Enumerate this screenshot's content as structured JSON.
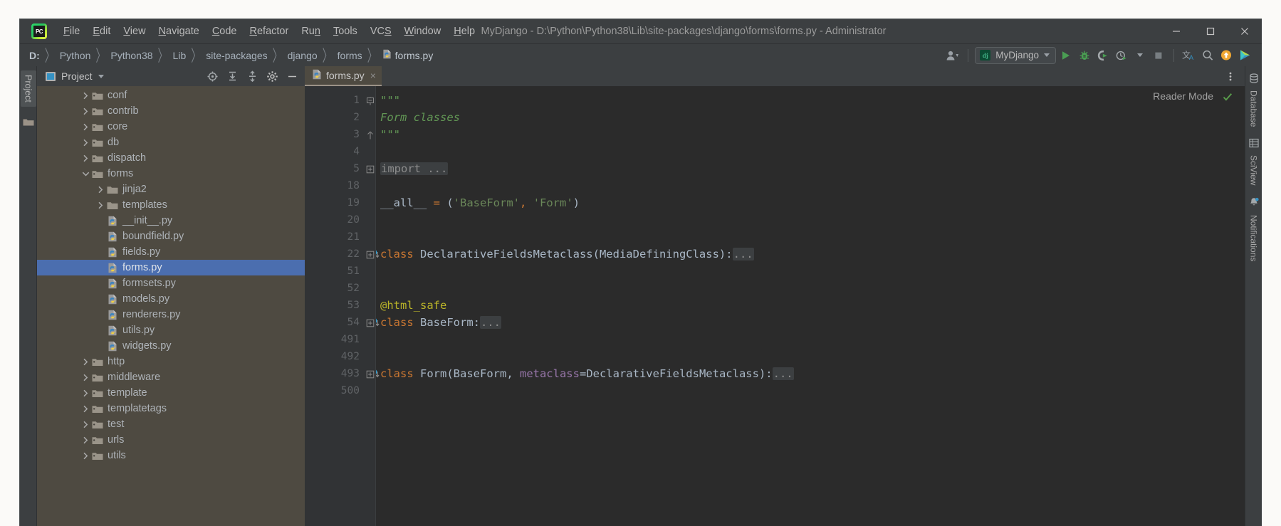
{
  "window": {
    "title": "MyDjango - D:\\Python\\Python38\\Lib\\site-packages\\django\\forms\\forms.py - Administrator",
    "app_icon": "pycharm-logo-icon",
    "minimize_label": "Minimize",
    "maximize_label": "Maximize",
    "close_label": "Close"
  },
  "menubar": {
    "items": [
      {
        "label": "File",
        "mnemonic": "F"
      },
      {
        "label": "Edit",
        "mnemonic": "E"
      },
      {
        "label": "View",
        "mnemonic": "V"
      },
      {
        "label": "Navigate",
        "mnemonic": "N"
      },
      {
        "label": "Code",
        "mnemonic": "C"
      },
      {
        "label": "Refactor",
        "mnemonic": "R"
      },
      {
        "label": "Run",
        "mnemonic": "n"
      },
      {
        "label": "Tools",
        "mnemonic": "T"
      },
      {
        "label": "VCS",
        "mnemonic": "S"
      },
      {
        "label": "Window",
        "mnemonic": "W"
      },
      {
        "label": "Help",
        "mnemonic": "H"
      }
    ]
  },
  "breadcrumb": {
    "items": [
      "D:",
      "Python",
      "Python38",
      "Lib",
      "site-packages",
      "django",
      "forms",
      "forms.py"
    ],
    "separator": "〉",
    "file_icon": "python-file-icon"
  },
  "toolbar": {
    "user_icon": "user-account-icon",
    "run_config": {
      "name": "MyDjango",
      "icon": "django-icon"
    },
    "buttons": [
      {
        "name": "run-button",
        "icon": "play-icon"
      },
      {
        "name": "debug-button",
        "icon": "bug-icon"
      },
      {
        "name": "run-with-coverage",
        "icon": "coverage-icon"
      },
      {
        "name": "profile-button",
        "icon": "clock-run-icon"
      },
      {
        "name": "stop-button",
        "icon": "stop-icon"
      },
      {
        "name": "translate-button",
        "icon": "translate-icon"
      },
      {
        "name": "search-everywhere",
        "icon": "search-icon"
      },
      {
        "name": "update-project",
        "icon": "arrow-up-circle-icon"
      },
      {
        "name": "plugin-button",
        "icon": "color-play-icon"
      }
    ]
  },
  "left_rail": {
    "tab_label": "Project",
    "folder_icon": "folder-icon"
  },
  "right_rail": {
    "items": [
      {
        "label": "Database",
        "icon": "database-icon"
      },
      {
        "label": "SciView",
        "icon": "sciview-icon"
      },
      {
        "label": "Notifications",
        "icon": "bell-icon"
      }
    ]
  },
  "project_panel": {
    "title": "Project",
    "dropdown_icon": "chevron-down-icon",
    "header_buttons": [
      {
        "name": "select-opened-file-button",
        "icon": "target-icon"
      },
      {
        "name": "expand-all-button",
        "icon": "expand-all-icon"
      },
      {
        "name": "collapse-all-button",
        "icon": "collapse-all-icon"
      },
      {
        "name": "options-button",
        "icon": "gear-icon"
      },
      {
        "name": "hide-button",
        "icon": "minus-icon"
      }
    ],
    "tree": [
      {
        "label": "conf",
        "kind": "folder",
        "depth": 2,
        "state": "collapsed"
      },
      {
        "label": "contrib",
        "kind": "folder",
        "depth": 2,
        "state": "collapsed"
      },
      {
        "label": "core",
        "kind": "folder",
        "depth": 2,
        "state": "collapsed"
      },
      {
        "label": "db",
        "kind": "folder",
        "depth": 2,
        "state": "collapsed"
      },
      {
        "label": "dispatch",
        "kind": "folder",
        "depth": 2,
        "state": "collapsed"
      },
      {
        "label": "forms",
        "kind": "folder",
        "depth": 2,
        "state": "expanded"
      },
      {
        "label": "jinja2",
        "kind": "plain-folder",
        "depth": 3,
        "state": "collapsed"
      },
      {
        "label": "templates",
        "kind": "plain-folder",
        "depth": 3,
        "state": "collapsed"
      },
      {
        "label": "__init__.py",
        "kind": "python",
        "depth": 3,
        "state": "leaf"
      },
      {
        "label": "boundfield.py",
        "kind": "python",
        "depth": 3,
        "state": "leaf"
      },
      {
        "label": "fields.py",
        "kind": "python",
        "depth": 3,
        "state": "leaf"
      },
      {
        "label": "forms.py",
        "kind": "python",
        "depth": 3,
        "state": "leaf",
        "selected": true
      },
      {
        "label": "formsets.py",
        "kind": "python",
        "depth": 3,
        "state": "leaf"
      },
      {
        "label": "models.py",
        "kind": "python",
        "depth": 3,
        "state": "leaf"
      },
      {
        "label": "renderers.py",
        "kind": "python",
        "depth": 3,
        "state": "leaf"
      },
      {
        "label": "utils.py",
        "kind": "python",
        "depth": 3,
        "state": "leaf"
      },
      {
        "label": "widgets.py",
        "kind": "python",
        "depth": 3,
        "state": "leaf"
      },
      {
        "label": "http",
        "kind": "folder",
        "depth": 2,
        "state": "collapsed"
      },
      {
        "label": "middleware",
        "kind": "folder",
        "depth": 2,
        "state": "collapsed"
      },
      {
        "label": "template",
        "kind": "folder",
        "depth": 2,
        "state": "collapsed"
      },
      {
        "label": "templatetags",
        "kind": "folder",
        "depth": 2,
        "state": "collapsed"
      },
      {
        "label": "test",
        "kind": "folder",
        "depth": 2,
        "state": "collapsed"
      },
      {
        "label": "urls",
        "kind": "folder",
        "depth": 2,
        "state": "collapsed"
      },
      {
        "label": "utils",
        "kind": "folder",
        "depth": 2,
        "state": "collapsed"
      }
    ]
  },
  "editor": {
    "tabs": [
      {
        "label": "forms.py",
        "icon": "python-file-icon",
        "close": "×",
        "active": true
      }
    ],
    "more_icon": "more-vertical-icon",
    "reader_mode_label": "Reader Mode",
    "inspection_icon": "checkmark-icon",
    "lines": [
      {
        "num": "1",
        "fold": "collapse-start",
        "segments": [
          {
            "t": "\"\"\"",
            "c": "tok-doc"
          }
        ]
      },
      {
        "num": "2",
        "fold": "",
        "segments": [
          {
            "t": "Form classes",
            "c": "tok-doc"
          }
        ]
      },
      {
        "num": "3",
        "fold": "collapse-end",
        "segments": [
          {
            "t": "\"\"\"",
            "c": "tok-doc"
          }
        ]
      },
      {
        "num": "4",
        "fold": "",
        "segments": []
      },
      {
        "num": "5",
        "fold": "expand",
        "segments": [
          {
            "t": "import ...",
            "c": "folded"
          }
        ]
      },
      {
        "num": "18",
        "fold": "",
        "segments": []
      },
      {
        "num": "19",
        "fold": "",
        "segments": [
          {
            "t": "__all__ ",
            "c": "tok-id"
          },
          {
            "t": "=",
            "c": "tok-op"
          },
          {
            "t": " (",
            "c": "tok-id"
          },
          {
            "t": "'BaseForm'",
            "c": "tok-str"
          },
          {
            "t": ",",
            "c": "tok-op"
          },
          {
            "t": " ",
            "c": "tok-id"
          },
          {
            "t": "'Form'",
            "c": "tok-str"
          },
          {
            "t": ")",
            "c": "tok-id"
          }
        ]
      },
      {
        "num": "20",
        "fold": "",
        "segments": []
      },
      {
        "num": "21",
        "fold": "",
        "segments": []
      },
      {
        "num": "22",
        "fold": "expand",
        "gutter_mark": "implemented-method-icon",
        "segments": [
          {
            "t": "class ",
            "c": "tok-kw"
          },
          {
            "t": "DeclarativeFieldsMetaclass(MediaDefiningClass):",
            "c": "tok-cls"
          },
          {
            "t": "...",
            "c": "folded"
          }
        ]
      },
      {
        "num": "51",
        "fold": "",
        "segments": []
      },
      {
        "num": "52",
        "fold": "",
        "segments": []
      },
      {
        "num": "53",
        "fold": "",
        "segments": [
          {
            "t": "@html_safe",
            "c": "tok-deco"
          }
        ]
      },
      {
        "num": "54",
        "fold": "expand",
        "gutter_mark": "implemented-method-icon",
        "segments": [
          {
            "t": "class ",
            "c": "tok-kw"
          },
          {
            "t": "BaseForm:",
            "c": "tok-cls"
          },
          {
            "t": "...",
            "c": "folded"
          }
        ]
      },
      {
        "num": "491",
        "fold": "",
        "segments": []
      },
      {
        "num": "492",
        "fold": "",
        "segments": []
      },
      {
        "num": "493",
        "fold": "expand",
        "gutter_mark": "implemented-method-icon",
        "segments": [
          {
            "t": "class ",
            "c": "tok-kw"
          },
          {
            "t": "Form(BaseForm, ",
            "c": "tok-cls"
          },
          {
            "t": "metaclass",
            "c": "tok-kwarg"
          },
          {
            "t": "=DeclarativeFieldsMetaclass):",
            "c": "tok-cls"
          },
          {
            "t": "...",
            "c": "folded"
          }
        ]
      },
      {
        "num": "500",
        "fold": "",
        "segments": []
      }
    ]
  },
  "colors": {
    "chrome": "#3c3f41",
    "editor_bg": "#2b2b2b",
    "gutter_bg": "#313335",
    "project_bg": "#4e4a41",
    "selection": "#4b6eaf",
    "keyword": "#cc7832",
    "string": "#6a8759",
    "docstring": "#629755",
    "decorator": "#bbb529",
    "kwarg": "#9876aa",
    "default_text": "#a9b7c6",
    "run_green": "#4a9e53"
  }
}
